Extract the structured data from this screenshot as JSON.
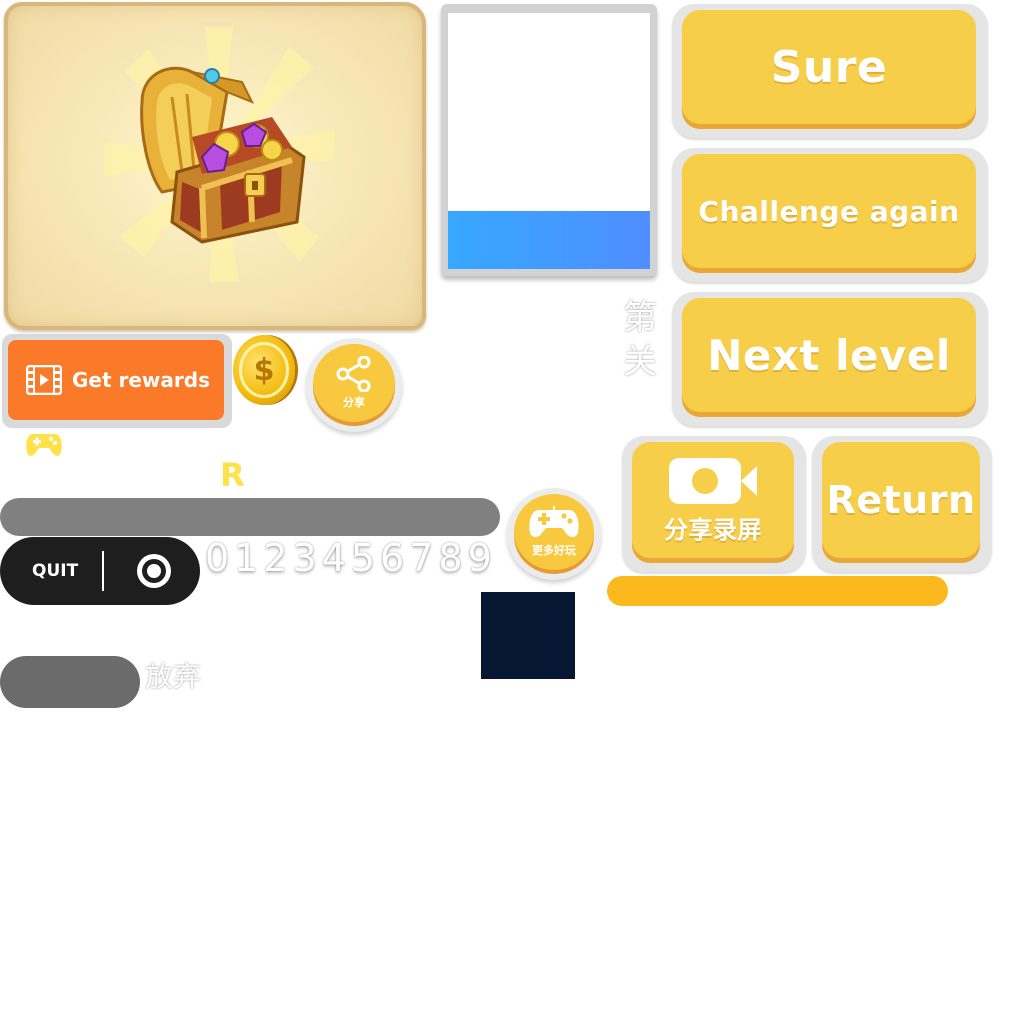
{
  "buttons": {
    "sure": "Sure",
    "challenge_again": "Challenge again",
    "next_level": "Next level",
    "return": "Return",
    "share_record": "分享录屏",
    "get_rewards": "Get rewards",
    "share_round": "分享",
    "more_games": "更多好玩",
    "quit": "QUIT"
  },
  "labels": {
    "digits": "0123456789",
    "r_letter": "R",
    "give_up": "放弃",
    "level_char_1": "第",
    "level_char_2": "关"
  },
  "coin_symbol": "$",
  "colors": {
    "button_yellow": "#f7ce49",
    "button_shadow": "#e9a836",
    "reward_orange": "#fb7a2a",
    "quit_black": "#1e1e1e",
    "blue_bar": "#36a8ff",
    "navy_block": "#071633",
    "progress_yellow": "#fbb91d"
  },
  "icons": [
    "treasure-chest-icon",
    "video-film-icon",
    "coin-dollar-icon",
    "share-icon",
    "gamepad-icon",
    "camera-icon",
    "target-icon"
  ]
}
